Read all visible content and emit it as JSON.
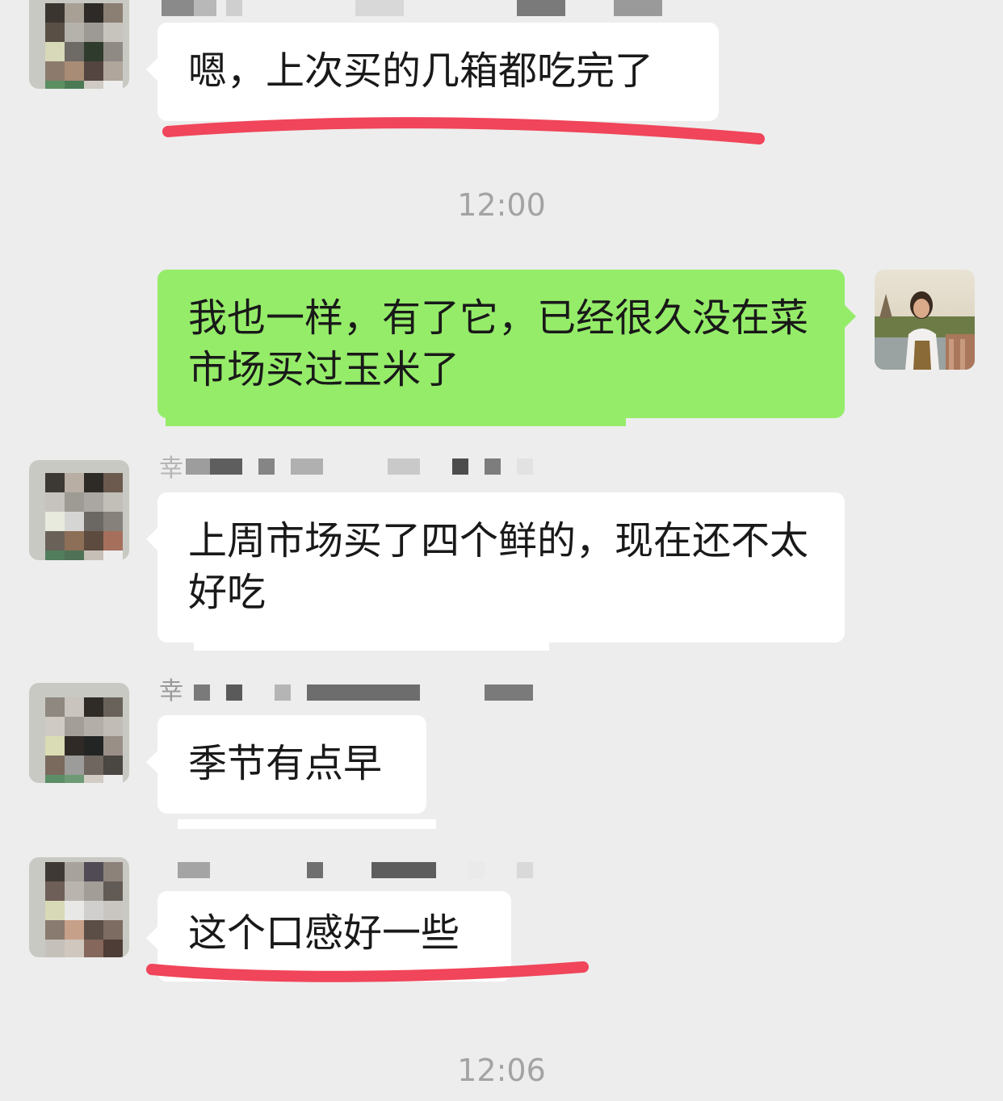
{
  "messages": [
    {
      "sender": "other",
      "text": "嗯，上次买的几箱都吃完了",
      "highlighted": true
    },
    {
      "sender": "self",
      "text": "我也一样，有了它，已经很久没在菜市场买过玉米了"
    },
    {
      "sender": "other",
      "name_initial": "幸",
      "text": "上周市场买了四个鲜的，现在还不太好吃"
    },
    {
      "sender": "other",
      "name_initial": "幸",
      "text": "季节有点早"
    },
    {
      "sender": "other",
      "text": "这个口感好一些",
      "highlighted": true
    }
  ],
  "timestamps": [
    "12:00",
    "12:06"
  ],
  "colors": {
    "background": "#ededed",
    "incoming_bubble": "#ffffff",
    "outgoing_bubble": "#95ec69",
    "highlight_marker": "#f0455a",
    "timestamp_text": "#a3a3a3"
  }
}
